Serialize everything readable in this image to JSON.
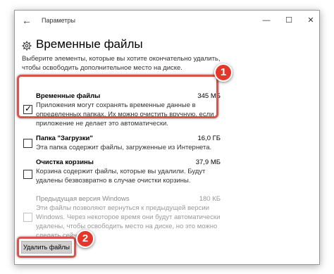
{
  "window": {
    "title": "Параметры",
    "controls": {
      "minimize": "—",
      "maximize": "☐",
      "close": "✕"
    }
  },
  "header": {
    "title": "Временные файлы",
    "description": "Выберите элементы, которые вы хотите окончательно удалить, чтобы освободить дополнительное место на диске."
  },
  "items": [
    {
      "name": "Временные файлы",
      "size": "345 МБ",
      "text": "Приложения могут сохранять временные данные в определенных папках. Их можно очистить вручную, если приложение не делает это автоматически.",
      "checked": true,
      "disabled": false
    },
    {
      "name": "Папка \"Загрузки\"",
      "size": "16,0 ГБ",
      "text": "Эта папка содержит файлы, загруженные из Интернета.",
      "checked": false,
      "disabled": false
    },
    {
      "name": "Очистка корзины",
      "size": "37,9 МБ",
      "text": "Корзина содержит файлы, которые вы удалили. Будут удалены безвозвратно в случае очистки корзины.",
      "checked": false,
      "disabled": false
    },
    {
      "name": "Предыдущая версия Windows",
      "size": "180 КБ",
      "text": "Эти файлы позволяют вернуться к предыдущей версии Windows. Через некоторое время они будут автоматически удалены, чтобы освободить место на диске, но это можно сделать сейчас.",
      "checked": false,
      "disabled": true
    }
  ],
  "actions": {
    "delete_label": "Удалить файлы"
  },
  "annotations": {
    "step1": "1",
    "step2": "2"
  },
  "colors": {
    "highlight": "#d9534f",
    "badge": "#e4362b"
  },
  "icons": {
    "back": "back-arrow-icon",
    "settings": "gear-icon",
    "check": "checkmark-icon"
  }
}
